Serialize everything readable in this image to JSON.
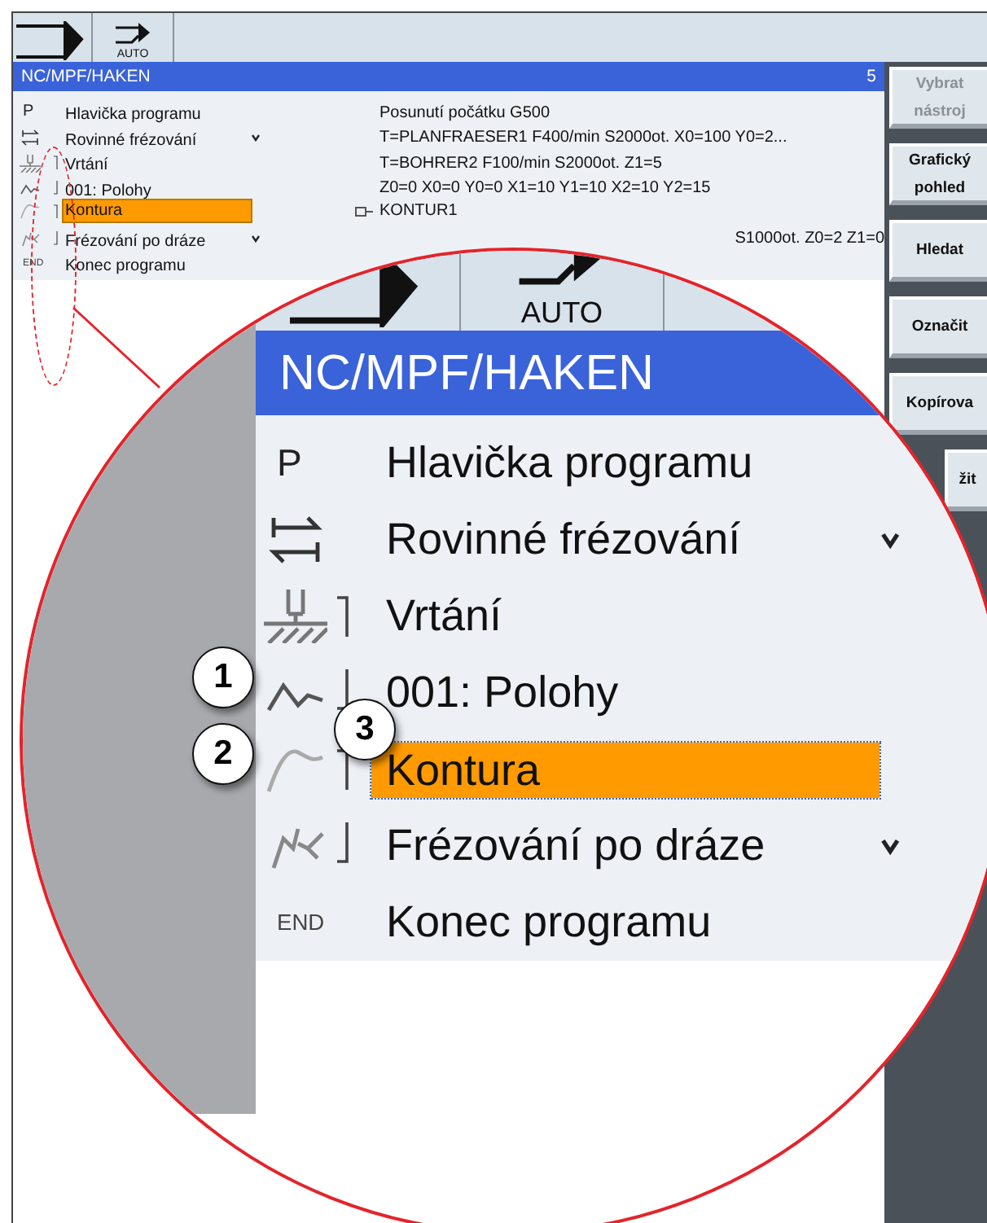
{
  "toolbar": {
    "mode_label": "AUTO"
  },
  "title_bar": {
    "path": "NC/MPF/HAKEN",
    "count": "5"
  },
  "program_steps": [
    {
      "kind": "header",
      "icon_text": "P",
      "grouped": false,
      "name": "Hlavička programu",
      "has_children": false,
      "selected": false,
      "detail": "Posunutí počátku G500",
      "detail_icon": false,
      "detail_cut": false
    },
    {
      "kind": "plane",
      "grouped": false,
      "name": "Rovinné frézování",
      "has_children": true,
      "selected": false,
      "detail": "T=PLANFRAESER1 F400/min S2000ot. X0=100 Y0=2...",
      "detail_icon": false,
      "detail_cut": false
    },
    {
      "kind": "drill",
      "grouped": true,
      "group_first": true,
      "name": "Vrtání",
      "has_children": false,
      "selected": false,
      "detail": "T=BOHRER2 F100/min S2000ot. Z1=5",
      "detail_icon": false,
      "detail_cut": false
    },
    {
      "kind": "positions",
      "grouped": true,
      "group_first": false,
      "name": "001: Polohy",
      "has_children": false,
      "selected": false,
      "detail": "Z0=0 X0=0 Y0=0 X1=10 Y1=10 X2=10 Y2=15",
      "detail_icon": false,
      "detail_cut": false
    },
    {
      "kind": "contour",
      "grouped": true,
      "group_first": true,
      "name": "Kontura",
      "has_children": false,
      "selected": true,
      "detail": "KONTUR1",
      "detail_icon": true,
      "detail_cut": false
    },
    {
      "kind": "path",
      "grouped": true,
      "group_first": false,
      "name": "Frézování po dráze",
      "has_children": true,
      "selected": false,
      "detail": "S1000ot. Z0=2 Z1=0",
      "detail_icon": false,
      "detail_cut": true
    },
    {
      "kind": "end",
      "icon_text": "END",
      "grouped": false,
      "name": "Konec programu",
      "has_children": false,
      "selected": false,
      "detail_icon": false,
      "detail_cut": false
    }
  ],
  "softkeys": [
    {
      "label": "Vybrat nástroj",
      "disabled": true
    },
    {
      "label": "Grafický pohled",
      "disabled": false
    },
    {
      "label": "Hledat",
      "disabled": false
    },
    {
      "label": "Označit",
      "disabled": false
    },
    {
      "label": "Kopírova",
      "disabled": false
    },
    {
      "label": "žit",
      "disabled": false
    }
  ],
  "magnifier": {
    "mode_label": "AUTO",
    "path": "NC/MPF/HAKEN",
    "steps": [
      {
        "kind": "header",
        "icon_text": "P",
        "grouped": false,
        "name": "Hlavička programu",
        "has_children": false,
        "selected": false
      },
      {
        "kind": "plane",
        "grouped": false,
        "name": "Rovinné frézování",
        "has_children": true,
        "selected": false
      },
      {
        "kind": "drill",
        "grouped": true,
        "group_first": true,
        "name": "Vrtání",
        "has_children": false,
        "selected": false
      },
      {
        "kind": "positions",
        "grouped": true,
        "group_first": false,
        "name": "001: Polohy",
        "has_children": false,
        "selected": false
      },
      {
        "kind": "contour",
        "grouped": true,
        "group_first": true,
        "name": "Kontura",
        "has_children": false,
        "selected": true
      },
      {
        "kind": "path",
        "grouped": true,
        "group_first": false,
        "name": "Frézování po dráze",
        "has_children": true,
        "selected": false
      },
      {
        "kind": "end",
        "icon_text": "END",
        "grouped": false,
        "name": "Konec programu",
        "has_children": false,
        "selected": false
      }
    ],
    "callouts": [
      "1",
      "2",
      "3"
    ]
  }
}
